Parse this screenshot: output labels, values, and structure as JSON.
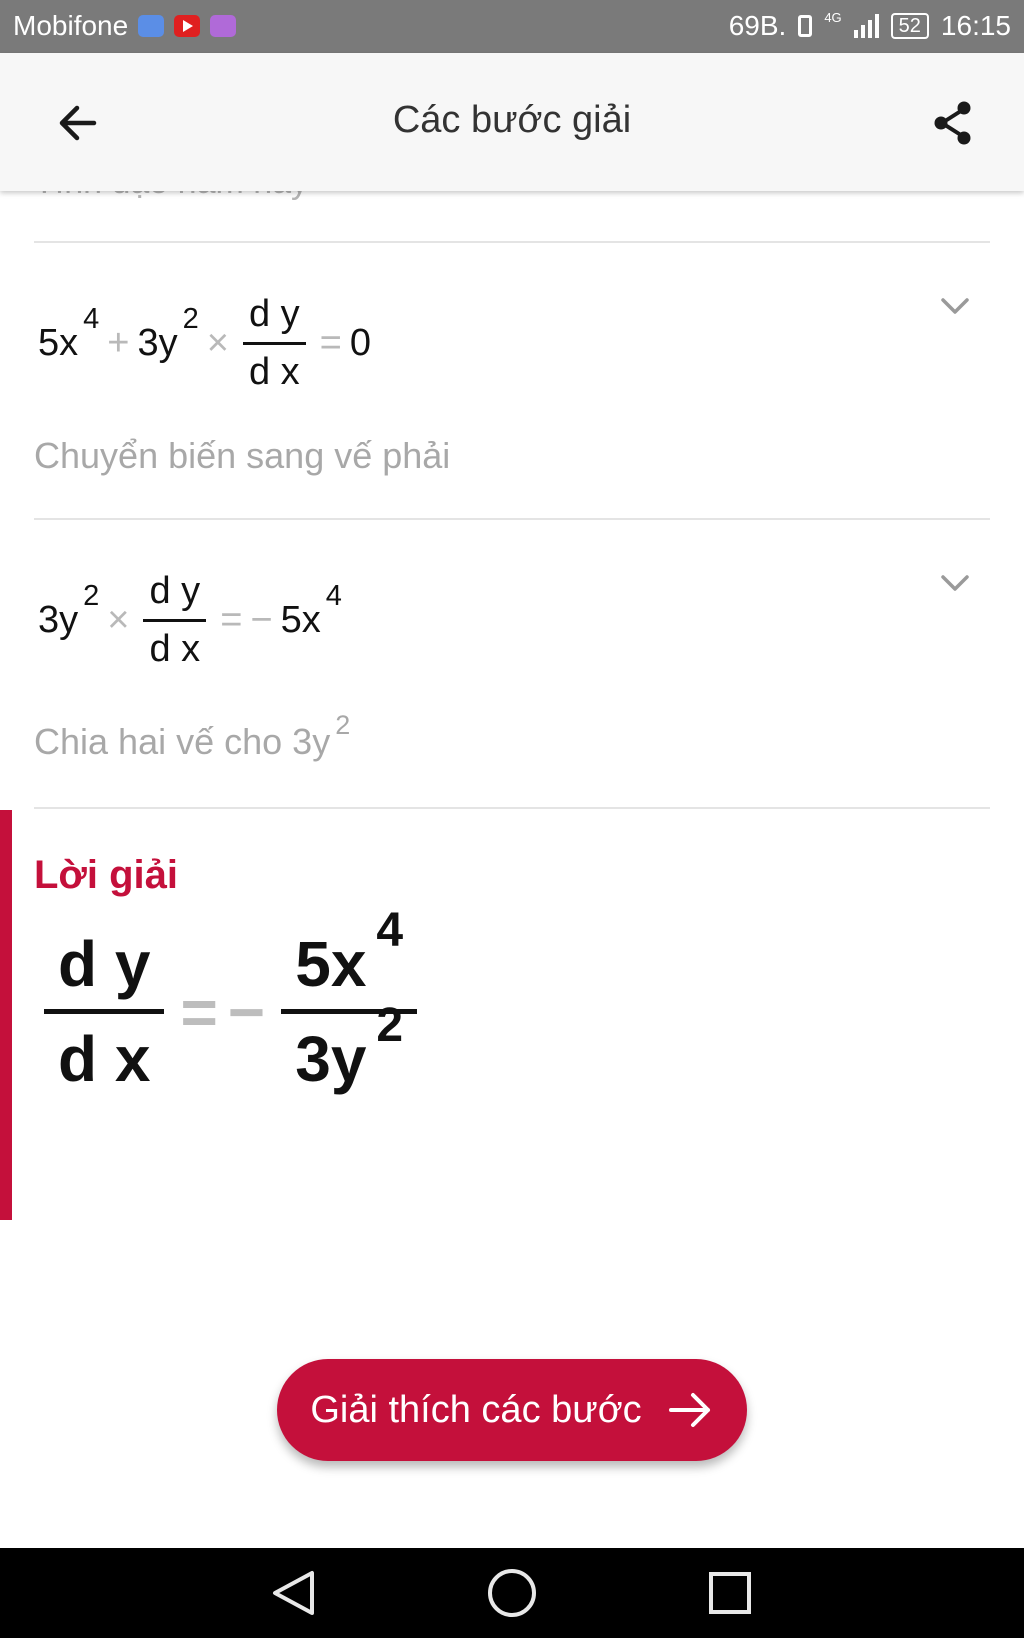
{
  "status_bar": {
    "carrier": "Mobifone",
    "app_icons": [
      "zalo-icon",
      "youtube-icon",
      "gallery-icon"
    ],
    "network_speed": "69B.",
    "network_type": "4G",
    "battery": "52",
    "time": "16:15"
  },
  "app_bar": {
    "title": "Các bước giải",
    "icons": [
      "arrow-left-icon",
      "share-icon"
    ]
  },
  "steps": {
    "previous_desc_cut": "Tính đạo hàm này",
    "step1": {
      "equation": {
        "t1_coef": "5x",
        "t1_exp": "4",
        "plus": "+",
        "t2_coef": "3y",
        "t2_exp": "2",
        "times": "×",
        "frac_num": "d y",
        "frac_den": "d x",
        "equals": "=",
        "rhs": "0"
      },
      "description": "Chuyển biến sang vế phải"
    },
    "step2": {
      "equation": {
        "t1_coef": "3y",
        "t1_exp": "2",
        "times": "×",
        "frac_num": "d y",
        "frac_den": "d x",
        "equals": "=",
        "minus": "−",
        "rhs_coef": "5x",
        "rhs_exp": "4"
      },
      "description_text": "Chia hai vế cho",
      "description_math": "3y",
      "description_exp": "2"
    }
  },
  "solution": {
    "label": "Lời giải",
    "lhs_num": "d y",
    "lhs_den": "d x",
    "equals": "=",
    "minus": "−",
    "rhs_num_coef": "5x",
    "rhs_num_exp": "4",
    "rhs_den_coef": "3y",
    "rhs_den_exp": "2"
  },
  "cta": {
    "label": "Giải thích các bước"
  },
  "colors": {
    "accent": "#c4103b",
    "status_bar": "#7a7a7a",
    "app_bar": "#f7f7f7",
    "muted_text": "#a8a8a8"
  },
  "nav_icons": [
    "back-triangle-icon",
    "home-circle-icon",
    "recents-square-icon"
  ]
}
